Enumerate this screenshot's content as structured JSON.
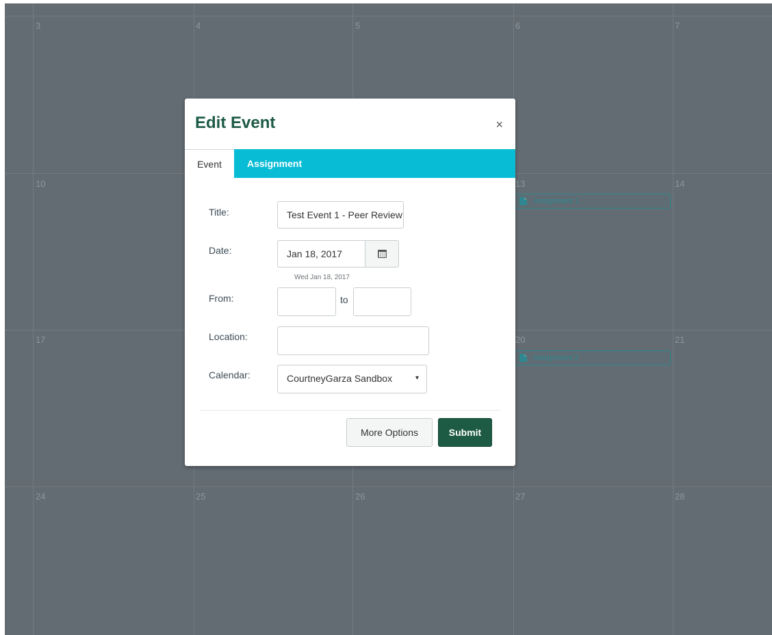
{
  "calendar": {
    "day_numbers": [
      "3",
      "4",
      "5",
      "6",
      "7",
      "10",
      "13",
      "14",
      "17",
      "20",
      "21",
      "24",
      "25",
      "26",
      "27",
      "28"
    ],
    "events": [
      {
        "label": "Assignment 1",
        "icon": "assignment-icon"
      },
      {
        "label": "Assignment 2",
        "icon": "assignment-icon"
      }
    ]
  },
  "modal": {
    "title": "Edit Event",
    "close_icon": "×",
    "tabs": [
      {
        "label": "Event",
        "active": true
      },
      {
        "label": "Assignment",
        "active": false
      }
    ],
    "fields": {
      "title_label": "Title:",
      "title_value": "Test Event 1 - Peer Review",
      "date_label": "Date:",
      "date_value": "Jan 18, 2017",
      "date_hint": "Wed Jan 18, 2017",
      "from_label": "From:",
      "from_value": "",
      "to_label": "to",
      "to_value": "",
      "location_label": "Location:",
      "location_value": "",
      "calendar_label": "Calendar:",
      "calendar_value": "CourtneyGarza Sandbox",
      "select_arrow": "▾"
    },
    "buttons": {
      "more_options": "More Options",
      "submit": "Submit"
    }
  },
  "colors": {
    "overlay": "#636c72",
    "tab_bar": "#08bcd6",
    "brand_green": "#1d5b45",
    "event_teal": "#2f8891"
  }
}
